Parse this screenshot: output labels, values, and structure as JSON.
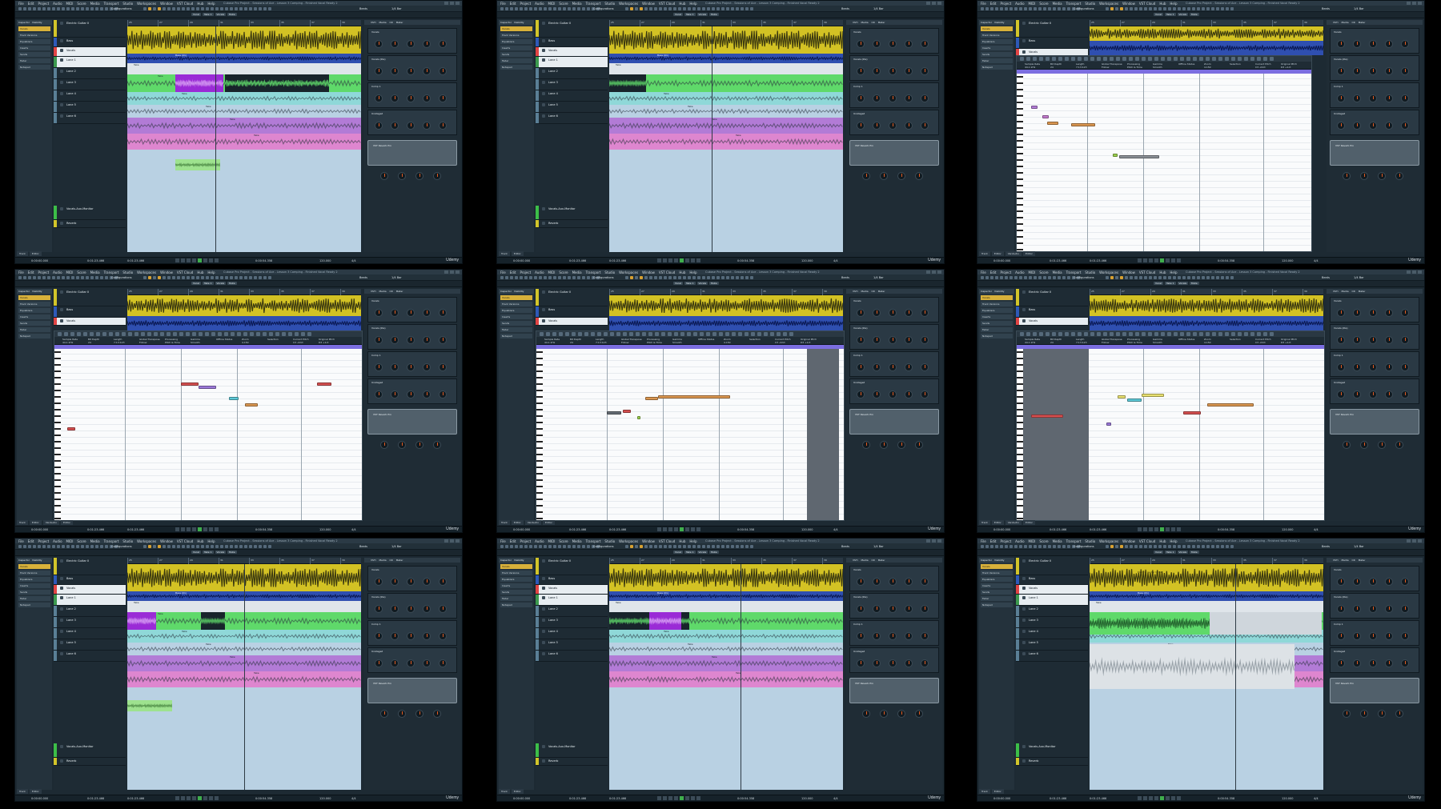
{
  "window": {
    "title": "Cubase Pro Project - Sessions of Ace - Lesson 3 Comping - Finished Vocal Ready 2",
    "menu": [
      "File",
      "Edit",
      "Project",
      "Audio",
      "MIDI",
      "Score",
      "Media",
      "Transport",
      "Studio",
      "Workspaces",
      "Window",
      "VST Cloud",
      "Hub",
      "Help"
    ]
  },
  "toolbar": {
    "configurations": "Configurations",
    "snap": "Beats",
    "quantize": "1/4 Bar"
  },
  "info_tags": [
    "Vocal",
    "Take 1",
    "Vocals",
    "Mute"
  ],
  "inspector": {
    "tabs": [
      "Inspector",
      "Visibility"
    ],
    "sections": [
      "Vocals",
      "Track Versions",
      "Equalizers",
      "Inserts",
      "Sends",
      "Fader",
      "Notepad"
    ]
  },
  "tracks": [
    {
      "name": "Electric Guitar II",
      "color": "#d2c52a"
    },
    {
      "name": "Bass",
      "sub": "(Copy of x1)",
      "color": "#2e59b8"
    },
    {
      "name": "Vocals",
      "color": "#e24444"
    },
    {
      "name": "Lane 1",
      "color": "#3c9a4e"
    },
    {
      "name": "Lane 2",
      "color": "#5a7f96"
    },
    {
      "name": "Lane 3",
      "color": "#5a7f96"
    },
    {
      "name": "Lane 4",
      "color": "#5a7f96"
    },
    {
      "name": "Lane 5",
      "color": "#5a7f96"
    },
    {
      "name": "Lane 6",
      "color": "#5a7f96"
    },
    {
      "name": "Vocals-Aux-Monitor",
      "color": "#3cbf48"
    },
    {
      "name": "Reverb",
      "color": "#d2c52a"
    }
  ],
  "ruler_labels": [
    "25",
    "27",
    "29",
    "31",
    "33",
    "35",
    "37",
    "39"
  ],
  "events": {
    "take_prefix": "Take",
    "bass": "Bass (01)",
    "guitar": "Electric Guitar II (01)"
  },
  "mixer": {
    "tabs": [
      "VSTi",
      "Media",
      "CR",
      "Meter"
    ],
    "strips": [
      "Vocals",
      "Vocals (lite)",
      "Comp 1",
      "Unstaged"
    ],
    "plugin": "VST Reverb Pro"
  },
  "editor": {
    "tabs": [
      "Track",
      "Editor",
      "VariAudio",
      "Editor"
    ],
    "info_headers": [
      "Sample Rate",
      "Bit Depth",
      "Length",
      "Global Transpose",
      "Processing",
      "Gamma",
      "Offline Status",
      "Zoom",
      "Selection",
      "Current Pitch",
      "Original Pitch"
    ],
    "info_values": [
      "44.1 kHz",
      "24",
      "7:13:123",
      "Follow",
      "Pitch & Time",
      "Smooth",
      "",
      "4.150",
      "",
      "C3 -22ct",
      "D3 +1ct"
    ]
  },
  "transport": {
    "left": "0:00:00.000",
    "right": "0:01:23.466",
    "pos": "0:01:23.466",
    "time_a": "0:00:54.358",
    "time_b": "0:00:14.637",
    "tempo": "120.000",
    "sig": "4/4"
  },
  "watermark": "Udemy",
  "colors": {
    "guitar": "#d3c224",
    "bass": "#2f4fb0",
    "lane_green": "#5fd96a",
    "lane_cyan": "#8fd8d8",
    "lane_purple": "#b27bd6",
    "lane_pink": "#de86cf",
    "project_bg": "#b9d1e3",
    "selection_purple": "#9a2bd6",
    "pitch_red": "#d45050",
    "pitch_orange": "#d99650",
    "pitch_purple": "#9a78d8",
    "pitch_yellow": "#e8e070",
    "pitch_cyan": "#5cc8d6",
    "pitch_green": "#9bd04c"
  }
}
